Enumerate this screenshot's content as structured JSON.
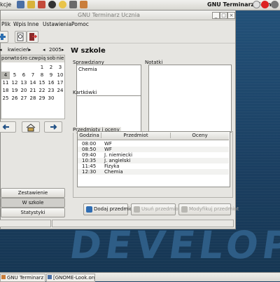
{
  "desktop": {
    "watermark": "DEVELOPE"
  },
  "top_panel": {
    "menu_fragment": "kcje",
    "active_window": "GNU Terminarz Ucznia"
  },
  "window": {
    "title": "GNU Terminarz Ucznia"
  },
  "menubar": [
    "Plik",
    "Wpis",
    "Inne",
    "Ustawienia",
    "Pomoc"
  ],
  "calendar": {
    "month": "kwiecień",
    "year": "2005",
    "weekdays": [
      "pon",
      "wto",
      "śro",
      "czw",
      "pią",
      "sob",
      "nie"
    ],
    "weeks": [
      [
        "",
        "",
        "",
        "",
        "1",
        "2",
        "3"
      ],
      [
        "4",
        "5",
        "6",
        "7",
        "8",
        "9",
        "10"
      ],
      [
        "11",
        "12",
        "13",
        "14",
        "15",
        "16",
        "17"
      ],
      [
        "18",
        "19",
        "20",
        "21",
        "22",
        "23",
        "24"
      ],
      [
        "25",
        "26",
        "27",
        "28",
        "29",
        "30",
        ""
      ]
    ],
    "selected_day": "4"
  },
  "side_buttons": {
    "summary": "Zestawienie",
    "at_school": "W szkole",
    "stats": "Statystyki"
  },
  "main": {
    "heading": "W szkole",
    "tests_label": "Sprawdziany",
    "tests_value": "Chemia",
    "notes_label": "Notatki",
    "quizzes_label": "Kartkówki",
    "subjects_label": "Przedmioty i oceny",
    "table_headers": [
      "Godzina",
      "Przedmiot",
      "Oceny"
    ],
    "rows": [
      [
        "08:00",
        "WF",
        ""
      ],
      [
        "08:50",
        "WF",
        ""
      ],
      [
        "09:40",
        "J. niemiecki",
        ""
      ],
      [
        "10:35",
        "J. angielski",
        ""
      ],
      [
        "11:45",
        "Fizyka",
        ""
      ],
      [
        "12:30",
        "Chemia",
        ""
      ]
    ],
    "add_button": "Dodaj przedmiot",
    "remove_button": "Usuń przedmiot",
    "modify_button": "Modyfikuj przedmiot"
  },
  "taskbar": {
    "task1": "GNU Terminarz Uczn",
    "task2": "[GNOME-Look.org -"
  },
  "colors": {
    "desktop": "#1f4466",
    "window_bg": "#e6e5e1"
  }
}
